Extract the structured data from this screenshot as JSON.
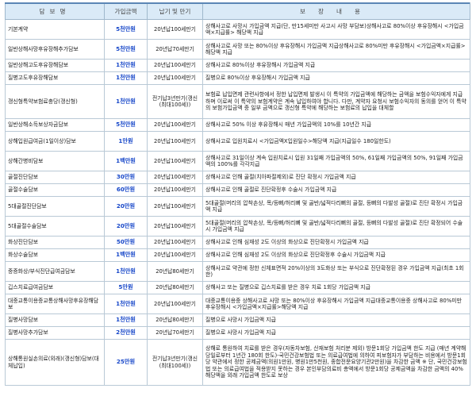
{
  "header": {
    "col1": "담보명",
    "col2": "가입금액",
    "col3": "납기 및 만기",
    "col4": "보장내용"
  },
  "rows": [
    {
      "name": "기본계약",
      "amount": "5천만원",
      "term": "20년납100세만기",
      "desc": "상해사고로 사망시 가입금액 지급(단, 만15세미만 사고시 사망 부담보)상해사고로 80%이상 후유장해시 <가입금액×지급률> 해당액 지급"
    },
    {
      "name": "일반상해사망후유장해추가담보",
      "amount": "5천만원",
      "term": "20년납70세만기",
      "desc": "상해사고로 사망 또는 80%이상 후유장해시 가입금액 지급상해사고로 80%미만 후유장해시 <가입금액×지급률>해당액 지급"
    },
    {
      "name": "일반상해고도후유장해담보",
      "amount": "1천만원",
      "term": "20년납100세만기",
      "desc": "상해사고로 80%이상 후유장해시 가입금액 지급"
    },
    {
      "name": "질병고도후유장해담보",
      "amount": "1천만원",
      "term": "20년납100세만기",
      "desc": "질병으로 80%이상 후유장해시 가입금액 지급"
    },
    {
      "name": "갱신형특약보험료충당(갱신형)",
      "amount": "1천만원",
      "term": "전기납3년만기(갱신(최대100세))",
      "desc": "보험료 납입면제 관련사항에서 정한 납입면제 발생시 이 특약의 가입금액에 해당하는 금액을 보험수익자에게 지급하며 이로써 이 특약의 보험계약은 계속 납입하여야 합니다. 다만, 계약자 요청시 보험수익자의 동의를 얻어 이 특약의 보험가입금액 중 일부 금액으로 갱신형 특약에 해당하는 보험료의 납입을 대체할"
    },
    {
      "name": "일반상해소득보상자금담보",
      "amount": "5천만원",
      "term": "20년납100세만기",
      "desc": "상해사고로 50% 이상 후유장해시 매년 가입금액의 10%를 10년간 지급"
    },
    {
      "name": "상해입원급여금(1일이상)담보",
      "amount": "1만원",
      "term": "20년납100세만기",
      "desc": "상해사고로 입원치료시 <가입금액X입원일수>해당액 지급(지급일수 180일한도)"
    },
    {
      "name": "상해간병비담보",
      "amount": "1백만원",
      "term": "20년납100세만기",
      "desc": "상해사고로 31일이상 계속 입원치료시 입원 31일째 가입금액의 50%, 61일째 가입금액의 50%, 91일째 가입금액의 100%를 각각지급"
    },
    {
      "name": "골절진단담보",
      "amount": "30만원",
      "term": "20년납100세만기",
      "desc": "상해사고로 인해 골절(치아파절제외)로 진단 확정시 가입금액 지급"
    },
    {
      "name": "골절수술담보",
      "amount": "60만원",
      "term": "20년납100세만기",
      "desc": "상해사고로 인해 골절로 진단확정후 수술시 가입금액 지급"
    },
    {
      "name": "5대골절진단담보",
      "amount": "20만원",
      "term": "20년납100세만기",
      "desc": "5대골절(머리의 압착손상, 목/등뼈/허리뼈 및 골반/넓적다리뼈의 골절, 등뼈의 다발성 골절)로 진단 확정시 가입금액 지급"
    },
    {
      "name": "5대골절수술담보",
      "amount": "20만원",
      "term": "20년납100세만기",
      "desc": "5대골절(머리의 압착손상, 목/등뼈/허리뼈 및 골반/넓적다리뼈의 골절, 등뼈의 다발성 골절)로 진단 확정되어 수술시 가입금액 지급"
    },
    {
      "name": "화상진단담보",
      "amount": "50만원",
      "term": "20년납100세만기",
      "desc": "상해사고로 인해 심재성 2도 이상의 화상으로 진단확정시 가입금액 지급"
    },
    {
      "name": "화상수술담보",
      "amount": "1백만원",
      "term": "20년납100세만기",
      "desc": "상해사고로 인해 심재성 2도 이상의 화상으로 진단확정후 수술시 가입금액 지급"
    },
    {
      "name": "중증화상/부식진단급여금담보",
      "amount": "1천만원",
      "term": "20년납80세만기",
      "desc": "상해사고로 약관에 정한 신체표면적 20%이상의 3도화상 또는 부식으로 진단확정된 경우 가입금액 지급(최초 1회한)"
    },
    {
      "name": "깁스치료급여금담보",
      "amount": "5만원",
      "term": "20년납80세만기",
      "desc": "상해사고 또는 질병으로 깁스치료를 받은 경우 치료 1회당 가입금액 지급"
    },
    {
      "name": "대중교통이용중교통상해사망후유장해담보",
      "amount": "1천만원",
      "term": "20년납100세만기",
      "desc": "대중교통이용중 상해사고로 사망 또는 80%이상 후유장해시 가입금액 지급대중교통이용중 상해사고로 80%미만 후유장해시 <가입금액×지급률>해당액 지급"
    },
    {
      "name": "질병사망담보",
      "amount": "1천만원",
      "term": "20년납80세만기",
      "desc": "질병으로 사망시 가입금액 지급"
    },
    {
      "name": "질병사망추가담보",
      "amount": "2천만원",
      "term": "20년납70세만기",
      "desc": "질병으로 사망시 가입금액 지급"
    },
    {
      "name": "상해통원실손의료(외래)(갱신형)담보(대체납입)",
      "amount": "25만원",
      "term": "전기납3년만기(갱신(최대100세))",
      "desc": "상해로 통원하여 치료를 받은 경우(자동차보험, 산재보험 처리분 제외) 방문1회당 가입금액 한도 지급 (매년 계약해당일로부터 1년간 180회 한도)-국민건강보험법 또는 의료급여법에 의하여 피보험자가 부담하는 비용에서 방문1회당 약관에서 정한 공제금액(의원1만원, 병원1만5천원, 종합전문요양기관2만원)을 차감한 금액 ※ 단, 국민건강보험법 또는 의료급여법을 적용받지 못하는 경우 본인부담의료비 총액에서 방문1회당 공제금액을 차감한 금액의 40%해당액을 외래 가입금액 한도로 보상"
    }
  ]
}
